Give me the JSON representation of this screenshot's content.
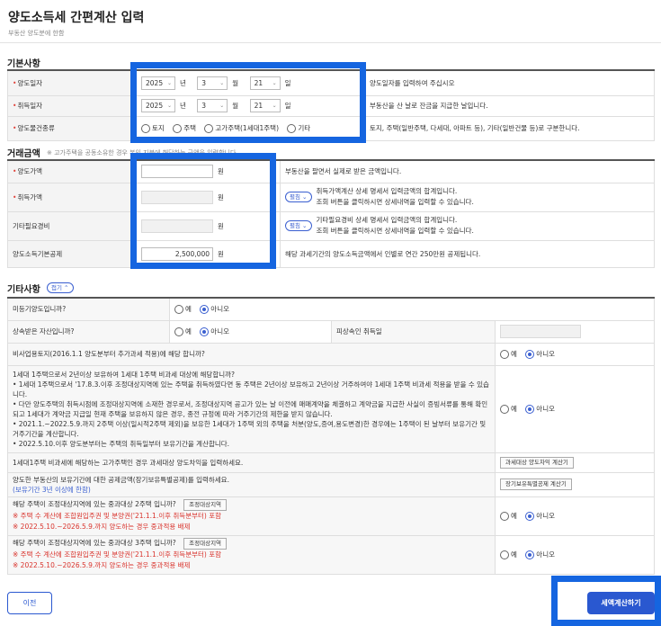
{
  "header": {
    "title": "양도소득세 간편계산 입력",
    "subtitle": "부동산 양도분에 한함"
  },
  "basic": {
    "title": "기본사항",
    "transfer_date": {
      "label": "양도일자",
      "year": "2025",
      "month": "3",
      "day": "21",
      "year_unit": "년",
      "month_unit": "월",
      "day_unit": "일",
      "desc": "양도일자를 입력하여 주십시오"
    },
    "acquire_date": {
      "label": "취득일자",
      "year": "2025",
      "month": "3",
      "day": "21",
      "year_unit": "년",
      "month_unit": "월",
      "day_unit": "일",
      "desc": "부동산을 산 날로 잔금을 지급한 날입니다."
    },
    "property_type": {
      "label": "양도물건종류",
      "options": [
        "토지",
        "주택",
        "고가주택(1세대1주택)",
        "기타"
      ],
      "desc": "토지, 주택(일반주택, 다세대, 아파트 등), 기타(일반건물 등)로 구분한니다."
    }
  },
  "amount": {
    "title": "거래금액",
    "note": "※ 고가주택을 공동소유한 경우 본인 지분에 해당하는 금액을 입력합니다.",
    "won": "원",
    "transfer_price": {
      "label": "양도가액",
      "value": "",
      "desc": "부동산을 팔면서 실제로 받은 금액입니다."
    },
    "acquire_price": {
      "label": "취득가액",
      "value": "",
      "button": "펼침",
      "desc1": "취득가액계산 상세 명세서 입력금액의 합계입니다.",
      "desc2": "조회 버튼을 클릭하시면 상세내역을 입력할 수 있습니다."
    },
    "other_expense": {
      "label": "기타필요경비",
      "value": "",
      "button": "펼침",
      "desc1": "기타필요경비 상세 명세서 입력금액의 합계입니다.",
      "desc2": "조회 버튼을 클릭하시면 상세내역을 입력할 수 있습니다."
    },
    "basic_deduction": {
      "label": "양도소득기본공제",
      "value": "2,500,000",
      "desc": "해당 과세기간의 양도소득금액에서 인별로 연간 250만원 공제됩니다."
    }
  },
  "other": {
    "title": "기타사항",
    "toggle": "접기",
    "yes": "예",
    "no": "아니오",
    "unregistered": {
      "label": "미등기양도입니까?"
    },
    "inherited": {
      "label": "상속받은 자산입니까?",
      "decedent_date_label": "피상속인 취득일"
    },
    "non_business_land": {
      "label": "비사업용토지(2016.1.1 양도분부터 추가과세 적용)에 해당 합니까?"
    },
    "one_house": {
      "q": "1세대 1주택으로서 2년이상 보유하여 1세대 1주택 비과세 대상에 해당합니까?",
      "b1": "• 1세대 1주택으로서 '17.8.3.이후 조정대상지역에 있는 주택을 취득하였다면 동 주택은 2년이상 보유하고 2년이상 거주하여야 1세대 1주택 비과세 적용을 받을 수 있습니다.",
      "b2": "• 다만 양도주택의 취득시점에 조정대상지역에 소재한 경우로서, 조정대상지역 공고가 있는 날 이전에 매매계약을 체결하고 계약금을 지급한 사실이 증빙서류를 통해 확인되고 1세대가 계약금 지급일 현재 주택을 보유하지 않은 경우, 종전 규정에 따라 거주기간의 제한을 받지 않습니다.",
      "b3": "• 2021.1.~2022.5.9.까지 2주택 이상(일시적2주택 제외)을 보유한 1세대가 1주택 외의 주택을 처분(양도,증여,용도변경)한 경우에는 1주택이 된 날부터 보유기간 및 거주기간을 계산합니다.",
      "b4": "• 2022.5.10.이후 양도분부터는 주택의 취득일부터 보유기간을 계산합니다."
    },
    "high_price_ratio": {
      "label": "1세대1주택 비과세에 해당하는 고가주택인 경우 과세대상 양도차익을 입력하세요.",
      "button": "과세대상 양도차익 계산기"
    },
    "long_term": {
      "label": "양도한 부동산의 보유기간에 대한 공제금액(장기보유특별공제)를 입력하세요.",
      "sub": "(보유기간 3년 이상에 한함)",
      "button": "장기보유특별공제 계산기"
    },
    "two_house": {
      "q": "해당 주택이 조정대상지역에 있는 중과대상 2주택 입니까?",
      "button": "조정대상지역",
      "w1": "※ 주택 수 계산에 조합원입주권 및 분양권('21.1.1.이후 취득분부터) 포함",
      "w2": "※ 2022.5.10.~2026.5.9.까지 양도하는 경우 중과적용 배제"
    },
    "three_house": {
      "q": "해당 주택이 조정대상지역에 있는 중과대상 3주택 입니까?",
      "button": "조정대상지역",
      "w1": "※ 주택 수 계산에 조합원입주권 및 분양권('21.1.1.이후 취득분부터) 포함",
      "w2": "※ 2022.5.10.~2026.5.9.까지 양도하는 경우 중과적용 배제"
    }
  },
  "footer": {
    "prev": "이전",
    "calc": "세액계산하기"
  },
  "colors": {
    "accent": "#2a58d0",
    "highlight": "#1565e0",
    "required": "#e0423a",
    "warning": "#d9332c"
  }
}
